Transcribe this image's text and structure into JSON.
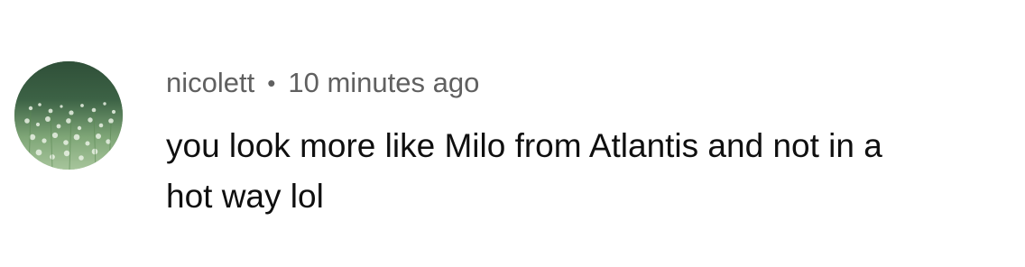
{
  "comment": {
    "author": "nicolett",
    "separator": "•",
    "timestamp": "10 minutes ago",
    "text_line1": "you look more like Milo from Atlantis and not in a",
    "text_line2": "hot way lol",
    "avatar_icon": "meadow-photo-avatar"
  },
  "colors": {
    "meta_text": "#606060",
    "body_text": "#0f0f0f",
    "background": "#ffffff"
  }
}
